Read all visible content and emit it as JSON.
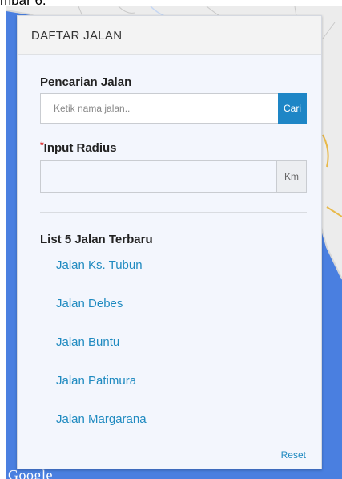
{
  "caption": "mbar 6.",
  "map": {
    "attribution": "Google",
    "water_color": "#4a7fe0",
    "land_color": "#ececec"
  },
  "panel": {
    "title": "DAFTAR JALAN",
    "search": {
      "label": "Pencarian Jalan",
      "placeholder": "Ketik nama jalan..",
      "button": "Cari"
    },
    "radius": {
      "required_mark": "*",
      "label": "Input Radius",
      "value": "",
      "unit": "Km"
    },
    "recent": {
      "heading": "List 5 Jalan Terbaru",
      "items": [
        {
          "label": "Jalan Ks. Tubun"
        },
        {
          "label": "Jalan Debes"
        },
        {
          "label": "Jalan Buntu"
        },
        {
          "label": "Jalan Patimura"
        },
        {
          "label": "Jalan Margarana"
        }
      ]
    },
    "reset": "Reset",
    "accent": "#1e86c6",
    "link_color": "#1f8ac0"
  }
}
